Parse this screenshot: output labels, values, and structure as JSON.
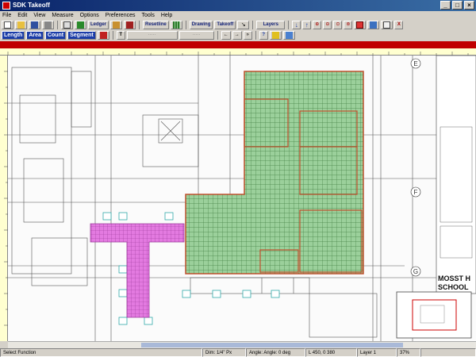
{
  "window": {
    "title": "SDK Takeoff"
  },
  "menu": [
    "File",
    "Edit",
    "View",
    "Measure",
    "Options",
    "Preferences",
    "Tools",
    "Help"
  ],
  "toolbar1": {
    "ledger_label": "Ledger",
    "resetlines_label": "Resetline",
    "drawing_label": "Drawing",
    "takeoff_label": "Takeoff",
    "layers_label": "Layers"
  },
  "toolbar2": {
    "length_label": "Length",
    "area_label": "Area",
    "count_label": "Count",
    "segment_label": "Segment",
    "calc_label": "Calculate"
  },
  "drawing": {
    "title_line1": "MOSST H",
    "title_line2": "SCHOOL",
    "grid_e": "E",
    "grid_f": "F",
    "grid_g": "G"
  },
  "status": {
    "left": "Select Function",
    "dim": "Dim: 1/4\" Px",
    "angle": "Angle: Angle: 0 deg",
    "coords": "L 450, 0 380",
    "layer": "Layer 1",
    "zoom": "37%"
  },
  "colors": {
    "green_area": "#9bd09b",
    "magenta_area": "#e37ae0",
    "highlight_border": "#c0502d",
    "accent": "#c00000"
  }
}
